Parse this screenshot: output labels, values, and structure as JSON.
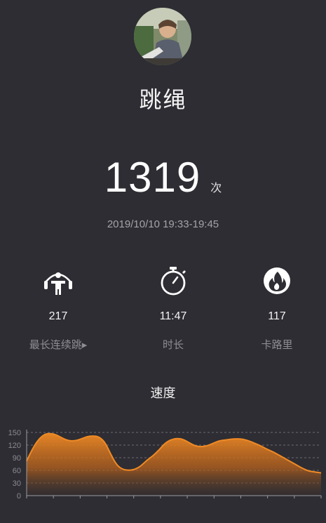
{
  "header": {
    "title": "跳绳"
  },
  "summary": {
    "count": "1319",
    "unit": "次",
    "datetime": "2019/10/10 19:33-19:45"
  },
  "stats": [
    {
      "icon": "jump-rope-icon",
      "value": "217",
      "label": "最长连续跳▸"
    },
    {
      "icon": "stopwatch-icon",
      "value": "11:47",
      "label": "时长"
    },
    {
      "icon": "flame-icon",
      "value": "117",
      "label": "卡路里"
    }
  ],
  "speed": {
    "title": "速度"
  },
  "colors": {
    "background": "#2d2d33",
    "accent": "#f08a24",
    "muted_text": "#8d8d93"
  },
  "chart_data": {
    "type": "area",
    "title": "速度",
    "ylim": [
      0,
      150
    ],
    "yticks": [
      0,
      30,
      60,
      90,
      120,
      150
    ],
    "ytick_labels": [
      "0",
      "30",
      "60",
      "90",
      "120",
      "150"
    ],
    "grid": true,
    "x": [
      0,
      1,
      2,
      3,
      4,
      5,
      6,
      7,
      8,
      9,
      10,
      11,
      12,
      13,
      14,
      15,
      16,
      17,
      18,
      19,
      20,
      21,
      22,
      23,
      24,
      25,
      26,
      27,
      28,
      29,
      30,
      31,
      32,
      33,
      34,
      35,
      36,
      37,
      38,
      39,
      40,
      41,
      42,
      43,
      44,
      45,
      46,
      47,
      48,
      49
    ],
    "values": [
      82,
      112,
      134,
      146,
      148,
      144,
      136,
      130,
      130,
      134,
      140,
      142,
      140,
      128,
      98,
      72,
      62,
      60,
      62,
      70,
      84,
      94,
      108,
      124,
      133,
      136,
      134,
      126,
      118,
      116,
      118,
      124,
      130,
      132,
      134,
      135,
      134,
      130,
      124,
      118,
      110,
      104,
      96,
      88,
      80,
      72,
      64,
      58,
      56,
      54
    ]
  }
}
